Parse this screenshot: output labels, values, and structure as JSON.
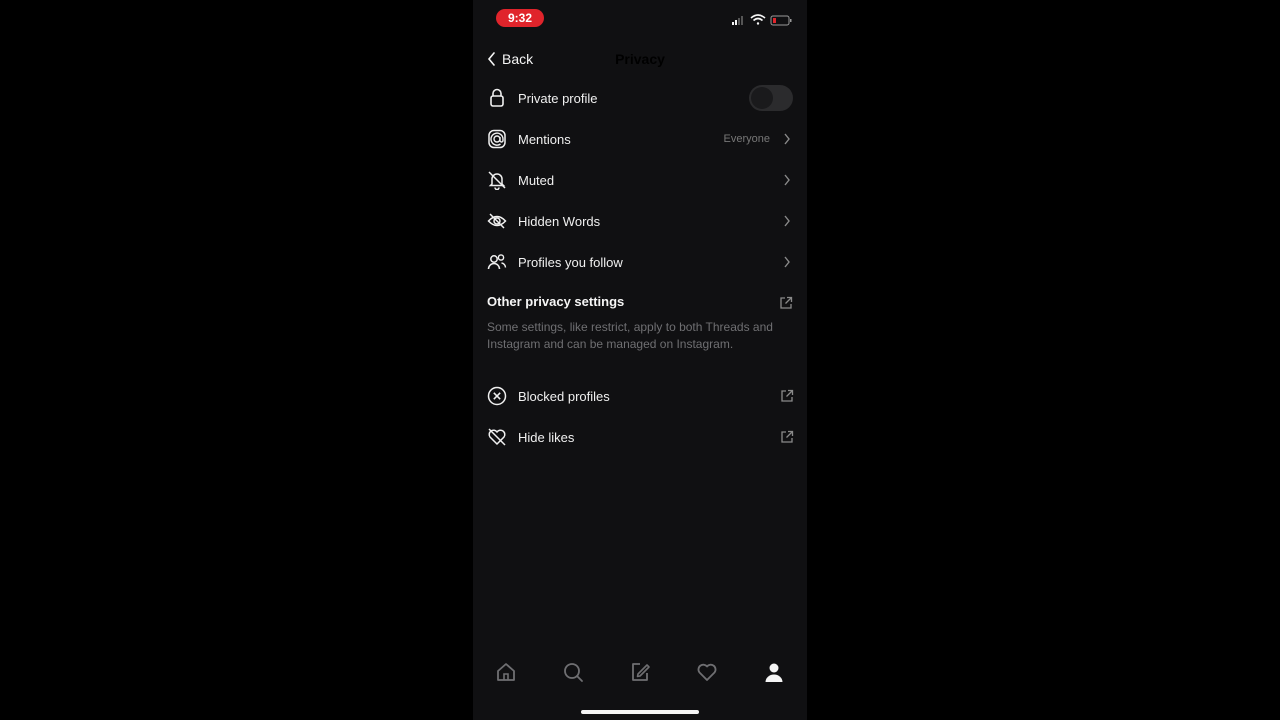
{
  "status": {
    "time": "9:32"
  },
  "nav": {
    "back_label": "Back",
    "title": "Privacy"
  },
  "items": [
    {
      "label": "Private profile",
      "icon": "lock-icon",
      "toggle_on": false
    },
    {
      "label": "Mentions",
      "icon": "at-sign-icon",
      "value": "Everyone"
    },
    {
      "label": "Muted",
      "icon": "bell-off-icon"
    },
    {
      "label": "Hidden Words",
      "icon": "eye-off-icon"
    },
    {
      "label": "Profiles you follow",
      "icon": "people-icon"
    }
  ],
  "other": {
    "title": "Other privacy settings",
    "note": "Some settings, like restrict, apply to both Threads and Instagram and can be managed on Instagram.",
    "items": [
      {
        "label": "Blocked profiles",
        "icon": "x-circle-icon"
      },
      {
        "label": "Hide likes",
        "icon": "heart-off-icon"
      }
    ]
  },
  "tabbar": [
    "home-icon",
    "search-icon",
    "compose-icon",
    "heart-icon",
    "profile-icon"
  ],
  "colors": {
    "background": "#101012",
    "status_pill": "#e0242b",
    "muted_text": "#6f6f72"
  }
}
